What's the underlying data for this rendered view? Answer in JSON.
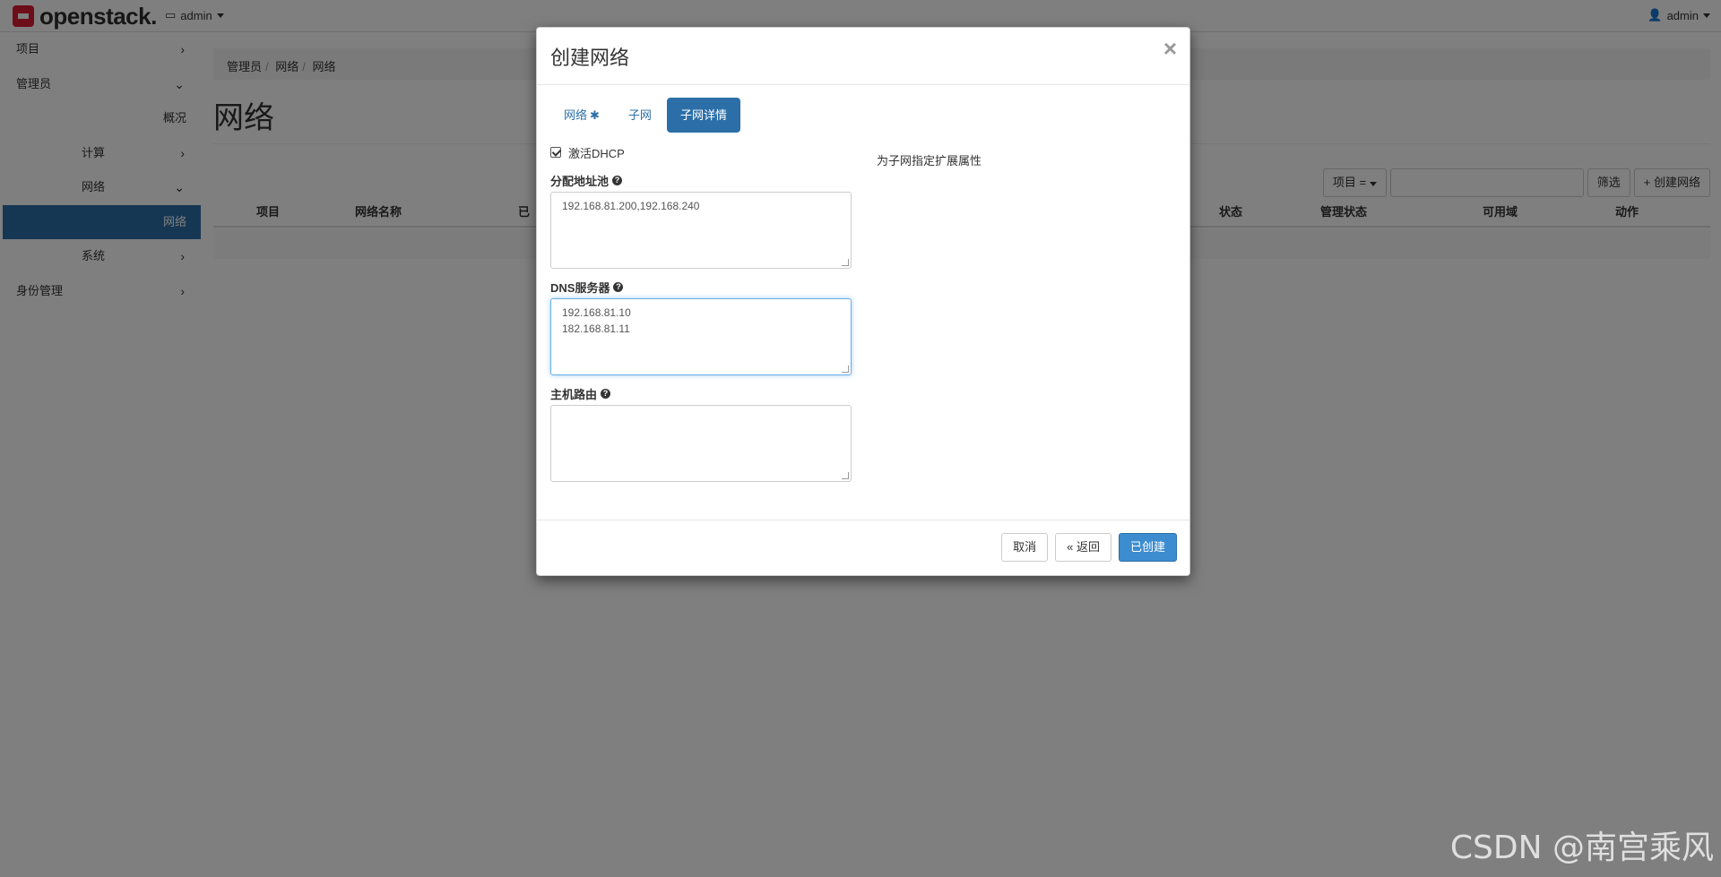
{
  "navbar": {
    "brand": "openstack.",
    "project_label": "admin",
    "user_label": "admin"
  },
  "sidebar": {
    "items": [
      {
        "label": "项目",
        "chevron": "›"
      },
      {
        "label": "管理员",
        "chevron": "⌄"
      },
      {
        "label": "概况"
      },
      {
        "label": "计算",
        "chevron": "›"
      },
      {
        "label": "网络",
        "chevron": "⌄"
      },
      {
        "label": "网络"
      },
      {
        "label": "系统",
        "chevron": "›"
      },
      {
        "label": "身份管理",
        "chevron": "›"
      }
    ]
  },
  "main": {
    "breadcrumb": [
      "管理员",
      "网络",
      "网络"
    ],
    "title": "网络",
    "filter": {
      "project_dd": "项目 =",
      "filter_btn": "筛选",
      "create_btn": "创建网络"
    },
    "table_headers": [
      "项目",
      "网络名称",
      "已",
      "状态",
      "管理状态",
      "可用域",
      "动作"
    ]
  },
  "modal": {
    "title": "创建网络",
    "close": "×",
    "tabs": [
      {
        "label": "网络",
        "required": "✱"
      },
      {
        "label": "子网"
      },
      {
        "label": "子网详情"
      }
    ],
    "dhcp_label": "激活DHCP",
    "pool_label": "分配地址池",
    "pool_value": "192.168.81.200,192.168.240",
    "dns_label": "DNS服务器",
    "dns_value": "192.168.81.10\n182.168.81.11",
    "routes_label": "主机路由",
    "routes_value": "",
    "help_text": "为子网指定扩展属性",
    "buttons": {
      "cancel": "取消",
      "back": "« 返回",
      "create": "已创建"
    }
  },
  "watermark": "CSDN @南宫乘风",
  "colors": {
    "accent": "#2c6fa8",
    "brand_red": "#da1a32"
  }
}
